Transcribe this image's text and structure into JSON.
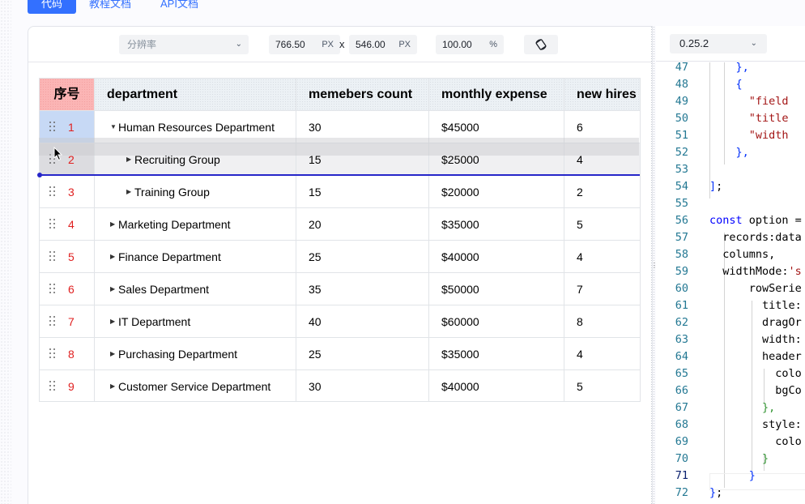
{
  "tabs": [
    {
      "label": "代码",
      "active": true
    },
    {
      "label": "教程文档",
      "active": false
    },
    {
      "label": "API文档",
      "active": false
    }
  ],
  "toolbar": {
    "resolution_placeholder": "分辨率",
    "width_value": "766.50",
    "width_unit": "PX",
    "separator": "x",
    "height_value": "546.00",
    "height_unit": "PX",
    "zoom_value": "100.00",
    "zoom_unit": "%"
  },
  "version": {
    "value": "0.25.2"
  },
  "table": {
    "headers": [
      "序号",
      "department",
      "memebers count",
      "monthly expense",
      "new hires"
    ],
    "rows": [
      {
        "no": "1",
        "department": "Human Resources Department",
        "level": 0,
        "expanded": true,
        "members": "30",
        "expense": "$45000",
        "hires": "6"
      },
      {
        "no": "2",
        "department": "Recruiting Group",
        "level": 1,
        "expanded": false,
        "members": "15",
        "expense": "$25000",
        "hires": "4"
      },
      {
        "no": "3",
        "department": "Training Group",
        "level": 1,
        "expanded": false,
        "members": "15",
        "expense": "$20000",
        "hires": "2"
      },
      {
        "no": "4",
        "department": "Marketing Department",
        "level": 0,
        "expanded": false,
        "members": "20",
        "expense": "$35000",
        "hires": "5"
      },
      {
        "no": "5",
        "department": "Finance Department",
        "level": 0,
        "expanded": false,
        "members": "25",
        "expense": "$40000",
        "hires": "4"
      },
      {
        "no": "6",
        "department": "Sales Department",
        "level": 0,
        "expanded": false,
        "members": "35",
        "expense": "$50000",
        "hires": "7"
      },
      {
        "no": "7",
        "department": "IT Department",
        "level": 0,
        "expanded": false,
        "members": "40",
        "expense": "$60000",
        "hires": "8"
      },
      {
        "no": "8",
        "department": "Purchasing Department",
        "level": 0,
        "expanded": false,
        "members": "25",
        "expense": "$35000",
        "hires": "4"
      },
      {
        "no": "9",
        "department": "Customer Service Department",
        "level": 0,
        "expanded": false,
        "members": "30",
        "expense": "$40000",
        "hires": "5"
      }
    ]
  },
  "code": {
    "first_line": 47,
    "current_line": 71,
    "lines": [
      [
        {
          "t": "    "
        },
        {
          "c": "b",
          "t": "},"
        }
      ],
      [
        {
          "t": "    "
        },
        {
          "c": "b",
          "t": "{"
        }
      ],
      [
        {
          "t": "      "
        },
        {
          "c": "s",
          "t": "\"field"
        }
      ],
      [
        {
          "t": "      "
        },
        {
          "c": "s",
          "t": "\"title"
        }
      ],
      [
        {
          "t": "      "
        },
        {
          "c": "s",
          "t": "\"width"
        }
      ],
      [
        {
          "t": "    "
        },
        {
          "c": "b",
          "t": "},"
        }
      ],
      [
        {
          "t": ""
        }
      ],
      [
        {
          "c": "b",
          "t": "]"
        },
        {
          "t": ";"
        }
      ],
      [
        {
          "t": ""
        }
      ],
      [
        {
          "c": "k",
          "t": "const"
        },
        {
          "t": " option ="
        }
      ],
      [
        {
          "t": "  records:data"
        }
      ],
      [
        {
          "t": "  columns,"
        }
      ],
      [
        {
          "t": "  widthMode:"
        },
        {
          "c": "s",
          "t": "'s"
        }
      ],
      [
        {
          "t": "      rowSerie"
        }
      ],
      [
        {
          "t": "        title:"
        }
      ],
      [
        {
          "t": "        dragOr"
        }
      ],
      [
        {
          "t": "        width:"
        }
      ],
      [
        {
          "t": "        header"
        }
      ],
      [
        {
          "t": "          colo"
        }
      ],
      [
        {
          "t": "          bgCo"
        }
      ],
      [
        {
          "t": "        "
        },
        {
          "c": "g",
          "t": "},"
        }
      ],
      [
        {
          "t": "        style:"
        }
      ],
      [
        {
          "t": "          colo"
        }
      ],
      [
        {
          "t": "        "
        },
        {
          "c": "g",
          "t": "}"
        }
      ],
      [
        {
          "t": "      "
        },
        {
          "c": "b",
          "t": "}"
        }
      ],
      [
        {
          "c": "b",
          "t": "}"
        },
        {
          "t": ";"
        }
      ]
    ]
  }
}
